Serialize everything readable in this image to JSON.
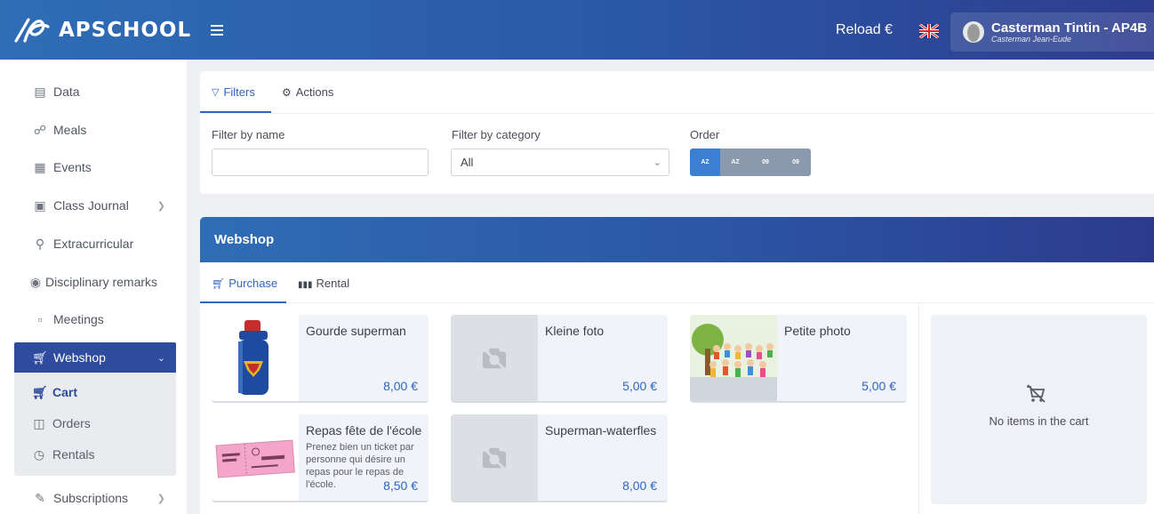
{
  "header": {
    "brand": "APSCHOOL",
    "reload_label": "Reload €",
    "user_name": "Casterman Tintin - AP4B",
    "user_sub": "Casterman Jean-Eude"
  },
  "sidebar": {
    "items": [
      {
        "label": "Data",
        "icon": "file-icon"
      },
      {
        "label": "Meals",
        "icon": "apple-icon"
      },
      {
        "label": "Events",
        "icon": "calendar-clock-icon"
      },
      {
        "label": "Class Journal",
        "icon": "journal-icon"
      },
      {
        "label": "Extracurricular",
        "icon": "key-icon"
      },
      {
        "label": "Disciplinary remarks",
        "icon": "fingerprint-icon"
      },
      {
        "label": "Meetings",
        "icon": "calendar-icon"
      },
      {
        "label": "Webshop",
        "icon": "cart-icon"
      },
      {
        "label": "Subscriptions",
        "icon": "pen-icon"
      }
    ],
    "webshop_sub": [
      {
        "label": "Cart",
        "icon": "cart-icon"
      },
      {
        "label": "Orders",
        "icon": "bag-icon"
      },
      {
        "label": "Rentals",
        "icon": "clock-icon"
      }
    ]
  },
  "filters": {
    "tab_filters": "Filters",
    "tab_actions": "Actions",
    "name_label": "Filter by name",
    "name_value": "",
    "category_label": "Filter by category",
    "category_value": "All",
    "order_label": "Order",
    "order_buttons": [
      "AZ",
      "AZ",
      "09",
      "09"
    ]
  },
  "webshop": {
    "title": "Webshop",
    "tab_purchase": "Purchase",
    "tab_rental": "Rental",
    "products": [
      {
        "title": "Gourde superman",
        "desc": "",
        "price": "8,00 €"
      },
      {
        "title": "Kleine foto",
        "desc": "",
        "price": "5,00 €"
      },
      {
        "title": "Petite photo",
        "desc": "",
        "price": "5,00 €"
      },
      {
        "title": "Repas fête de l'école",
        "desc": "Prenez bien un ticket par personne qui désire un repas pour le repas de l'école.",
        "price": "8,50 €"
      },
      {
        "title": "Superman-waterfles",
        "desc": "",
        "price": "8,00 €"
      }
    ],
    "cart_empty": "No items in the cart"
  },
  "colors": {
    "primary": "#2e4b9e",
    "accent": "#2e66c4"
  }
}
